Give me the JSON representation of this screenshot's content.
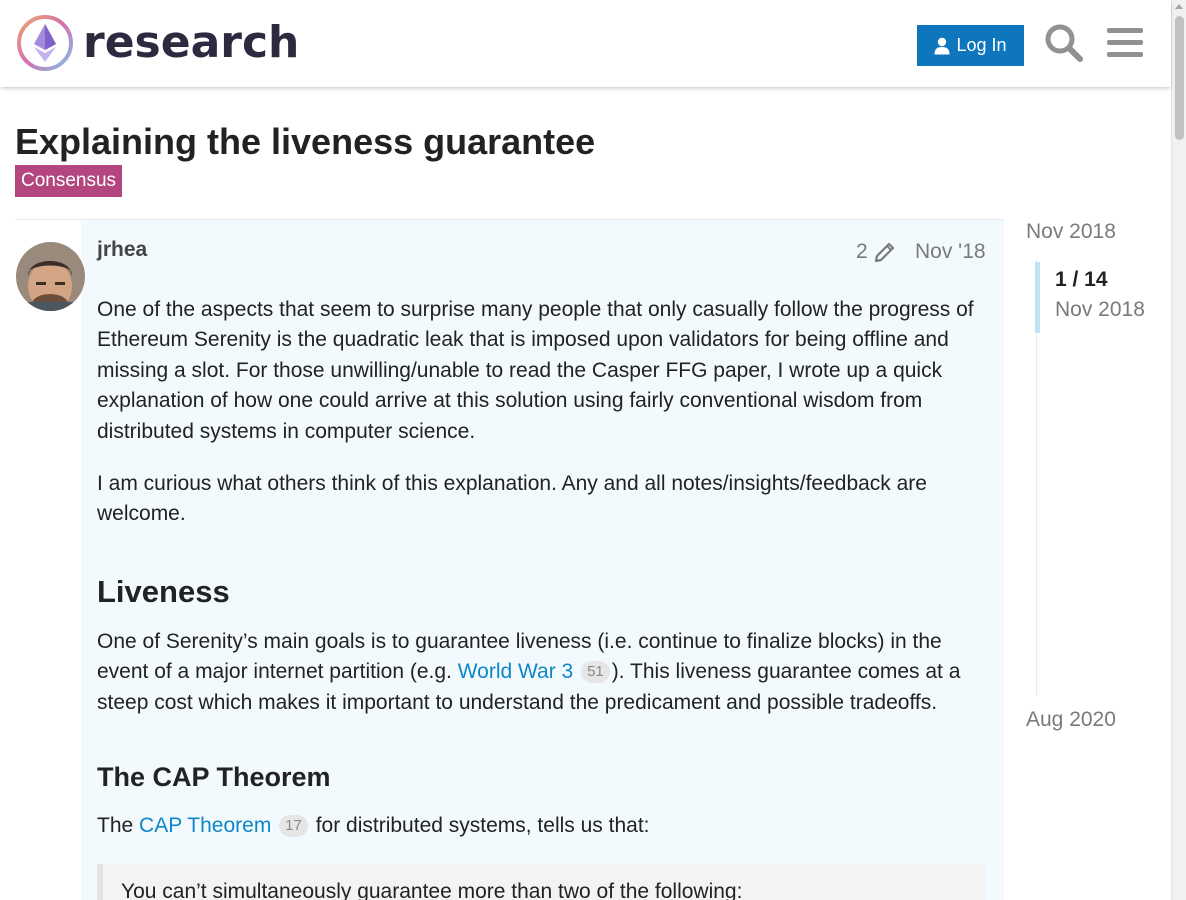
{
  "header": {
    "site_name": "research",
    "login_label": "Log In",
    "brand_color": "#0e76bd",
    "icons": [
      "ethereum-logo-icon",
      "user-icon",
      "search-icon",
      "hamburger-menu-icon"
    ]
  },
  "topic": {
    "title": "Explaining the liveness guarantee",
    "category": "Consensus",
    "category_color": "#b3467f"
  },
  "post": {
    "username": "jrhea",
    "edit_count": "2",
    "date": "Nov '18",
    "paragraph_1": "One of the aspects that seem to surprise many people that only casually follow the progress of Ethereum Serenity is the quadratic leak that is imposed upon validators for being offline and missing a slot. For those unwilling/unable to read the Casper FFG paper, I wrote up a quick explanation of how one could arrive at this solution using fairly conventional wisdom from distributed systems in computer science.",
    "paragraph_2": "I am curious what others think of this explanation. Any and all notes/insights/feedback are welcome.",
    "heading_liveness": "Liveness",
    "paragraph_3_before": "One of Serenity’s main goals is to guarantee liveness (i.e. continue to finalize blocks) in the event of a major internet partition (e.g. ",
    "link_ww3": "World War 3",
    "link_ww3_clicks": "51",
    "paragraph_3_after": "). This liveness guarantee comes at a steep cost which makes it important to understand the predicament and possible tradeoffs.",
    "heading_cap": "The CAP Theorem",
    "paragraph_4_before": "The ",
    "link_cap": "CAP Theorem",
    "link_cap_clicks": "17",
    "paragraph_4_after": " for distributed systems, tells us that:",
    "quote": "You can’t simultaneously guarantee more than two of the following:"
  },
  "timeline": {
    "start_date": "Nov 2018",
    "position": "1 / 14",
    "position_date": "Nov 2018",
    "end_date": "Aug 2020",
    "progress_fraction": 0.0714
  }
}
